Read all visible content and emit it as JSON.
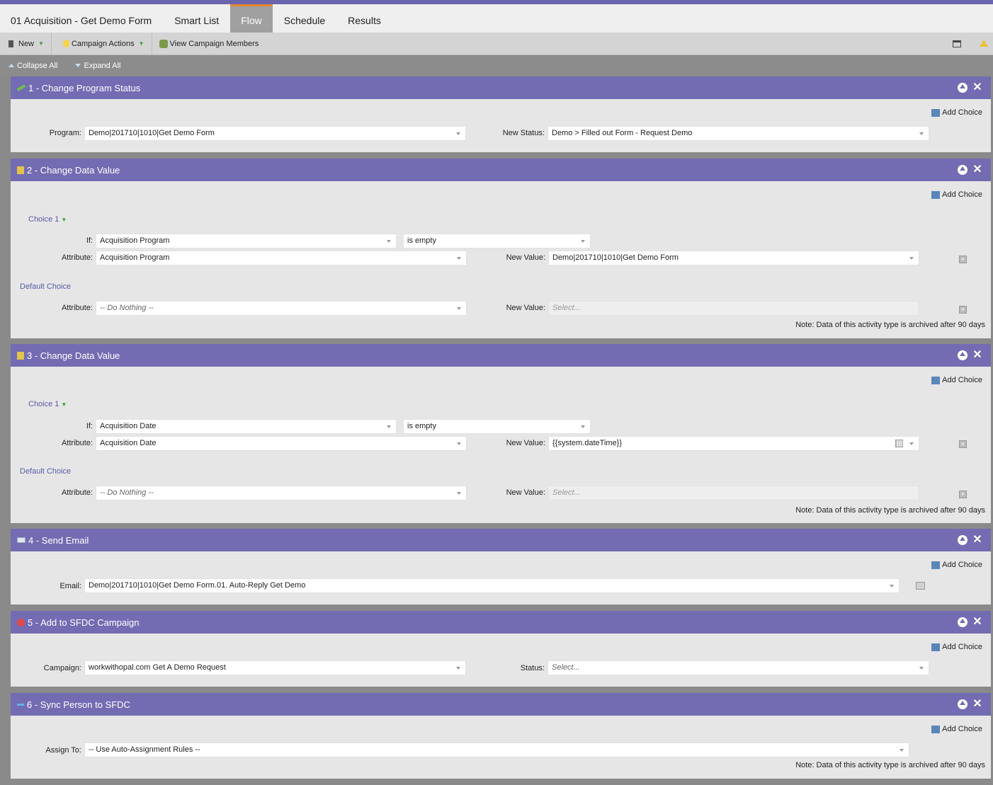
{
  "tabs": [
    "01 Acquisition - Get Demo Form",
    "Smart List",
    "Flow",
    "Schedule",
    "Results"
  ],
  "active_tab": "Flow",
  "toolbar": {
    "new_label": "New",
    "campaign_actions_label": "Campaign Actions",
    "view_members_label": "View Campaign Members"
  },
  "controls": {
    "collapse_all": "Collapse All",
    "expand_all": "Expand All"
  },
  "common": {
    "add_choice": "Add Choice",
    "note": "Note: Data of this activity type is archived after 90 days",
    "choice1": "Choice 1",
    "default_choice": "Default Choice",
    "if_label": "If:",
    "attribute_label": "Attribute:",
    "new_value_label": "New Value:",
    "select_placeholder": "Select...",
    "do_nothing": "-- Do Nothing --"
  },
  "steps": [
    {
      "title": "1 - Change Program Status",
      "program_label": "Program:",
      "program_value": "Demo|201710|1010|Get Demo Form",
      "status_label": "New Status:",
      "status_value": "Demo > Filled out Form - Request Demo"
    },
    {
      "title": "2 - Change Data Value",
      "if_attr": "Acquisition Program",
      "if_op": "is empty",
      "attribute": "Acquisition Program",
      "new_value": "Demo|201710|1010|Get Demo Form"
    },
    {
      "title": "3 - Change Data Value",
      "if_attr": "Acquisition Date",
      "if_op": "is empty",
      "attribute": "Acquisition Date",
      "new_value": "{{system.dateTime}}"
    },
    {
      "title": "4 - Send Email",
      "email_label": "Email:",
      "email_value": "Demo|201710|1010|Get Demo Form.01. Auto-Reply Get Demo"
    },
    {
      "title": "5 - Add to SFDC Campaign",
      "campaign_label": "Campaign:",
      "campaign_value": "workwithopal.com Get A Demo Request",
      "status_label": "Status:"
    },
    {
      "title": "6 - Sync Person to SFDC",
      "assign_label": "Assign To:",
      "assign_value": "-- Use Auto-Assignment Rules --"
    }
  ]
}
